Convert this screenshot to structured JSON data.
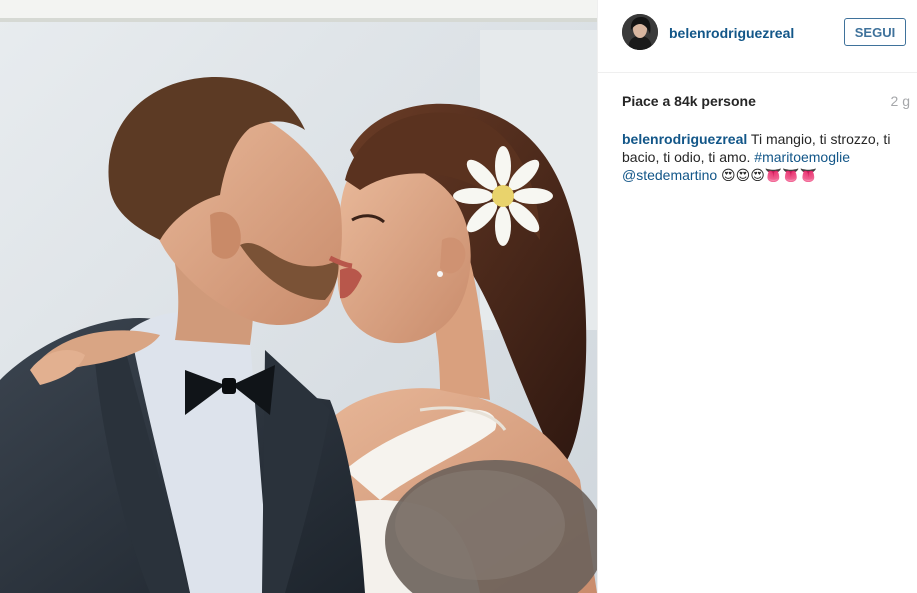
{
  "header": {
    "username": "belenrodriguezreal",
    "follow_label": "SEGUI"
  },
  "stats": {
    "likes": "Piace a 84k persone",
    "time_ago": "2 g"
  },
  "caption": {
    "username": "belenrodriguezreal",
    "text": "Ti mangio, ti strozzo, ti bacio, ti odio, ti amo.",
    "hashtag": "#maritoemoglie",
    "mention": "@stedemartino",
    "emoji": "😍😍😍👅👅👅"
  },
  "photo": {
    "icon": "wedding-couple-photo"
  },
  "colors": {
    "link": "#125688",
    "follow_border": "#3f729b",
    "muted": "#a5a7aa"
  }
}
